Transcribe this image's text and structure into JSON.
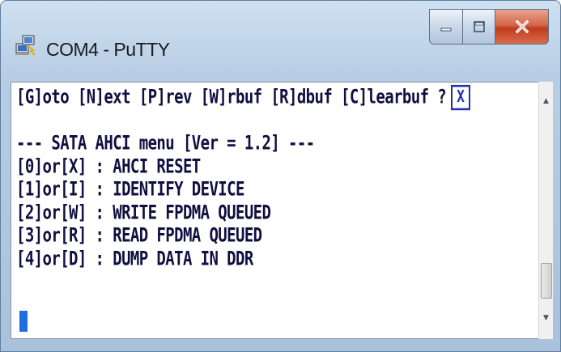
{
  "window": {
    "title": "COM4 - PuTTY",
    "app_icon": "putty-icon"
  },
  "controls": {
    "minimize_icon": "minimize-icon",
    "maximize_icon": "maximize-icon",
    "close_icon": "close-icon"
  },
  "terminal": {
    "menu_line": "[G]oto [N]ext [P]rev [W]rbuf [R]dbuf [C]learbuf ?",
    "menu_box": "X",
    "blank": "",
    "header": "--- SATA AHCI menu [Ver = 1.2] ---",
    "items": [
      "[0]or[X] : AHCI RESET",
      "[1]or[I] : IDENTIFY DEVICE",
      "[2]or[W] : WRITE FPDMA QUEUED",
      "[3]or[R] : READ FPDMA QUEUED",
      "[4]or[D] : DUMP DATA IN DDR"
    ]
  },
  "colors": {
    "title_bar": "#b7cde4",
    "close_button": "#c94a2a",
    "terminal_bg": "#ffffff",
    "terminal_text": "#101040",
    "cursor": "#1e6fe0"
  }
}
